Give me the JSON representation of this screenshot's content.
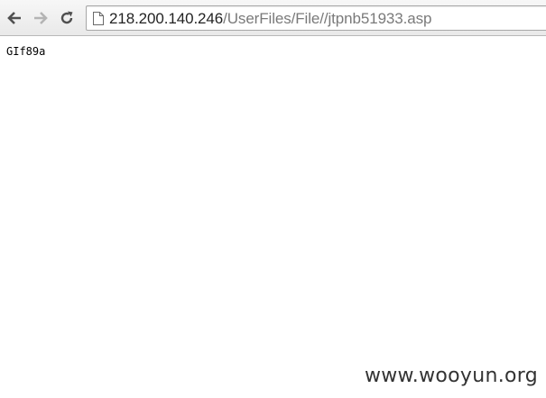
{
  "browser": {
    "url_host": "218.200.140.246",
    "url_path": "/UserFiles/File//jtpnb51933.asp",
    "icons": {
      "back": "back-arrow-icon",
      "forward": "forward-arrow-icon",
      "reload": "reload-icon",
      "page": "page-icon"
    }
  },
  "page": {
    "content": "GIf89a"
  },
  "watermark": {
    "text": "www.wooyun.org"
  }
}
